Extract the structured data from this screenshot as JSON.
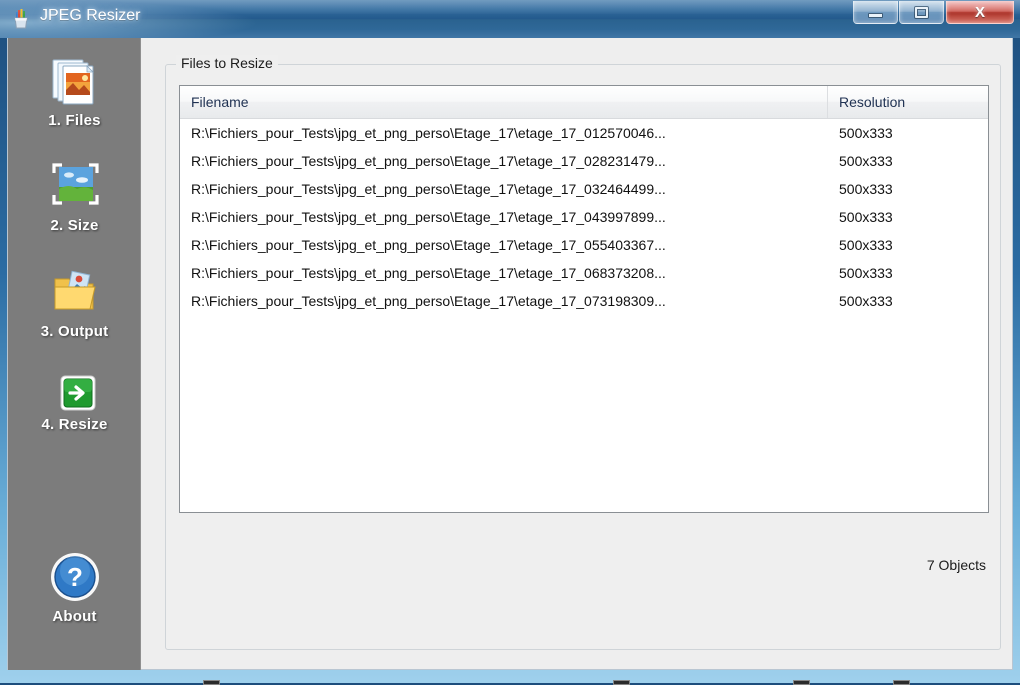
{
  "window": {
    "title": "JPEG Resizer",
    "app_icon": "pencil-cup-icon",
    "caption": {
      "minimize_label": "Minimize",
      "maximize_label": "Maximize",
      "close_label": "X"
    }
  },
  "sidebar": {
    "items": [
      {
        "icon": "photo-stack-icon",
        "label": "1. Files"
      },
      {
        "icon": "landscape-photo-icon",
        "label": "2. Size"
      },
      {
        "icon": "output-folder-icon",
        "label": "3. Output"
      },
      {
        "icon": "green-arrow-icon",
        "label": "4. Resize"
      },
      {
        "icon": "question-mark-icon",
        "label": "About"
      }
    ]
  },
  "main": {
    "group_title": "Files to Resize",
    "table": {
      "columns": [
        "Filename",
        "Resolution"
      ],
      "rows": [
        {
          "filename": "R:\\Fichiers_pour_Tests\\jpg_et_png_perso\\Etage_17\\etage_17_012570046...",
          "resolution": "500x333"
        },
        {
          "filename": "R:\\Fichiers_pour_Tests\\jpg_et_png_perso\\Etage_17\\etage_17_028231479...",
          "resolution": "500x333"
        },
        {
          "filename": "R:\\Fichiers_pour_Tests\\jpg_et_png_perso\\Etage_17\\etage_17_032464499...",
          "resolution": "500x333"
        },
        {
          "filename": "R:\\Fichiers_pour_Tests\\jpg_et_png_perso\\Etage_17\\etage_17_043997899...",
          "resolution": "500x333"
        },
        {
          "filename": "R:\\Fichiers_pour_Tests\\jpg_et_png_perso\\Etage_17\\etage_17_055403367...",
          "resolution": "500x333"
        },
        {
          "filename": "R:\\Fichiers_pour_Tests\\jpg_et_png_perso\\Etage_17\\etage_17_068373208...",
          "resolution": "500x333"
        },
        {
          "filename": "R:\\Fichiers_pour_Tests\\jpg_et_png_perso\\Etage_17\\etage_17_073198309...",
          "resolution": "500x333"
        }
      ]
    },
    "objects_count": "7 Objects",
    "bottom_controls": [
      {
        "name": "collapsed-button-1",
        "glyph": "dash"
      },
      {
        "name": "collapsed-button-2",
        "glyph": "dash"
      },
      {
        "name": "collapsed-button-3",
        "glyph": "dash"
      },
      {
        "name": "collapsed-button-4",
        "glyph": "dash"
      }
    ]
  },
  "colors": {
    "titlebar": "#2b6ca3",
    "sidebar": "#7c7c7c",
    "client": "#eeeeee",
    "list_bg": "#ffffff",
    "header_text": "#1f3152",
    "close_button": "#c43b30",
    "green_accent": "#1f9a2e"
  }
}
